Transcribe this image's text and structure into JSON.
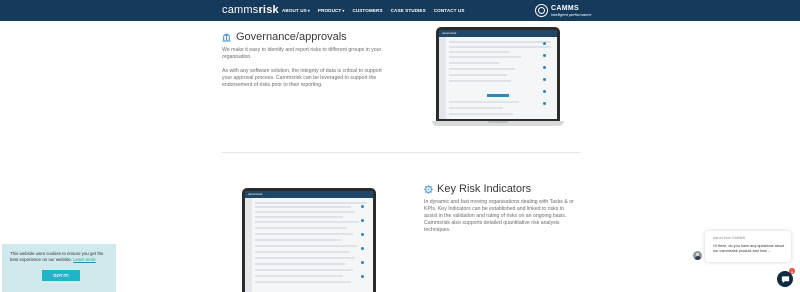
{
  "header": {
    "logo_light": "camms",
    "logo_bold": "risk",
    "nav": [
      {
        "label": "ABOUT US",
        "dropdown": true
      },
      {
        "label": "PRODUCT",
        "dropdown": true
      },
      {
        "label": "CUSTOMERS",
        "dropdown": false
      },
      {
        "label": "CASE STUDIES",
        "dropdown": false
      },
      {
        "label": "CONTACT US",
        "dropdown": false
      }
    ],
    "brand_name": "CAMMS",
    "brand_tagline": "intelligent performance",
    "bg_color": "#163a5c"
  },
  "governance": {
    "icon": "bank-icon",
    "title": "Governance/approvals",
    "para1": "We make it easy to identify and report risks to different groups in your organisation.",
    "para2": "As with any software solution, the integrity of data is critical to support your approval process. Cammsrisk can be leveraged to support the endorsement of risks prior to their reporting."
  },
  "kri": {
    "icon": "gear-icon",
    "title": "Key Risk Indicators",
    "para": "In dynamic and fast moving organisations dealing with Tasks & or KPIs, Key Indicators can be established and linked to risks to assist in the validation and rating of risks on an ongoing basis. Cammsrisk also supports detailed quantitative risk analysis techniques."
  },
  "cookie": {
    "text": "This website uses cookies to ensure you get the best experience on our website.",
    "link": "Learn more",
    "button": "GOT IT!",
    "bg_color": "#cfe9ec",
    "button_color": "#1fb5c8"
  },
  "chat": {
    "from": "Aaron from CAMMS",
    "message": "Hi there, do you have any questions about our cammsrisk product and how ...",
    "badge_count": "1",
    "launcher_icon": "chat-icon"
  }
}
